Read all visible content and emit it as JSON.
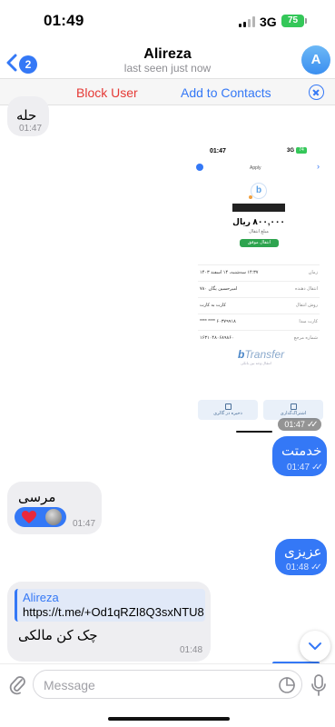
{
  "status_bar": {
    "time": "01:49",
    "network": "3G",
    "battery": "75"
  },
  "header": {
    "back_badge": "2",
    "contact_name": "Alireza",
    "last_seen": "last seen just now",
    "avatar_initial": "A"
  },
  "action_bar": {
    "block_label": "Block User",
    "add_label": "Add to Contacts"
  },
  "messages": [
    {
      "direction": "in",
      "text": "حله",
      "time": "01:47"
    },
    {
      "direction": "out",
      "type": "image",
      "time": "01:47",
      "receipt": {
        "status_time": "01:47",
        "network": "3G",
        "battery": "74",
        "header": "Apply",
        "logo_letter": "b",
        "amount": "۸۰۰,۰۰۰ ریال",
        "amount_label": "مبلغ انتقال",
        "status": "انتقال موفق",
        "rows": [
          {
            "label": "زمان",
            "value": "۱۴:۳۷ سه‌شنبه، ۱۴ اسفند ۱۴۰۳"
          },
          {
            "label": "انتقال دهنده",
            "value": "امیرحسین یگان ۷۸۰"
          },
          {
            "label": "روش انتقال",
            "value": "کارت به کارت"
          },
          {
            "label": "کارت مبدا",
            "value": "۶۰۳۷۹۹۱۸ **** ****"
          },
          {
            "label": "شماره مرجع",
            "value": "۱۶۳۱۰۴۸۰۶۸۹۸۶۰"
          }
        ],
        "brand_b": "b",
        "brand_rest": "Transfer",
        "brand_tag": "انتقال وجه بین بانکی",
        "button_share": "اشتراک‌گذاری",
        "button_save": "ذخیره در گالری"
      }
    },
    {
      "direction": "out",
      "text": "خدمتت",
      "time": "01:47"
    },
    {
      "direction": "in",
      "text": "مرسی",
      "time": "01:47"
    },
    {
      "direction": "out",
      "text": "عزیزی",
      "time": "01:48"
    },
    {
      "direction": "in",
      "reply_name": "Alireza",
      "link": "https://t.me/+Od1qRZI8Q3sxNTU8",
      "text": "چک کن مالکی",
      "time": "01:48"
    }
  ],
  "composer": {
    "placeholder": "Message"
  }
}
